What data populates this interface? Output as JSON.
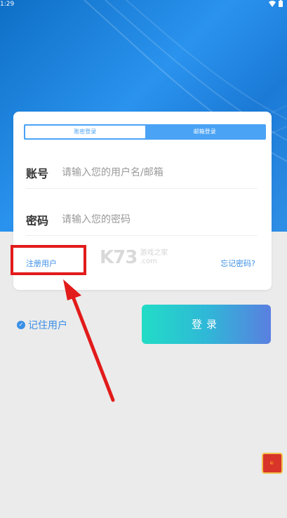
{
  "status_bar": {
    "time": "1:29"
  },
  "tabs": [
    {
      "label": "账密登录",
      "active": true
    },
    {
      "label": "邮箱登录",
      "active": false
    }
  ],
  "account": {
    "label": "账号",
    "placeholder": "请输入您的用户名/邮箱"
  },
  "password": {
    "label": "密码",
    "placeholder": "请输入您的密码"
  },
  "links": {
    "register": "注册用户",
    "forgot": "忘记密码?"
  },
  "remember_label": "记住用户",
  "login_label": "登录",
  "watermark": {
    "logo": "K73",
    "line1": "游戏之家",
    "line2": ".com"
  },
  "colors": {
    "accent": "#3a8ee6",
    "highlight": "#e21b1b",
    "tab_bg": "#4aa3f5"
  }
}
